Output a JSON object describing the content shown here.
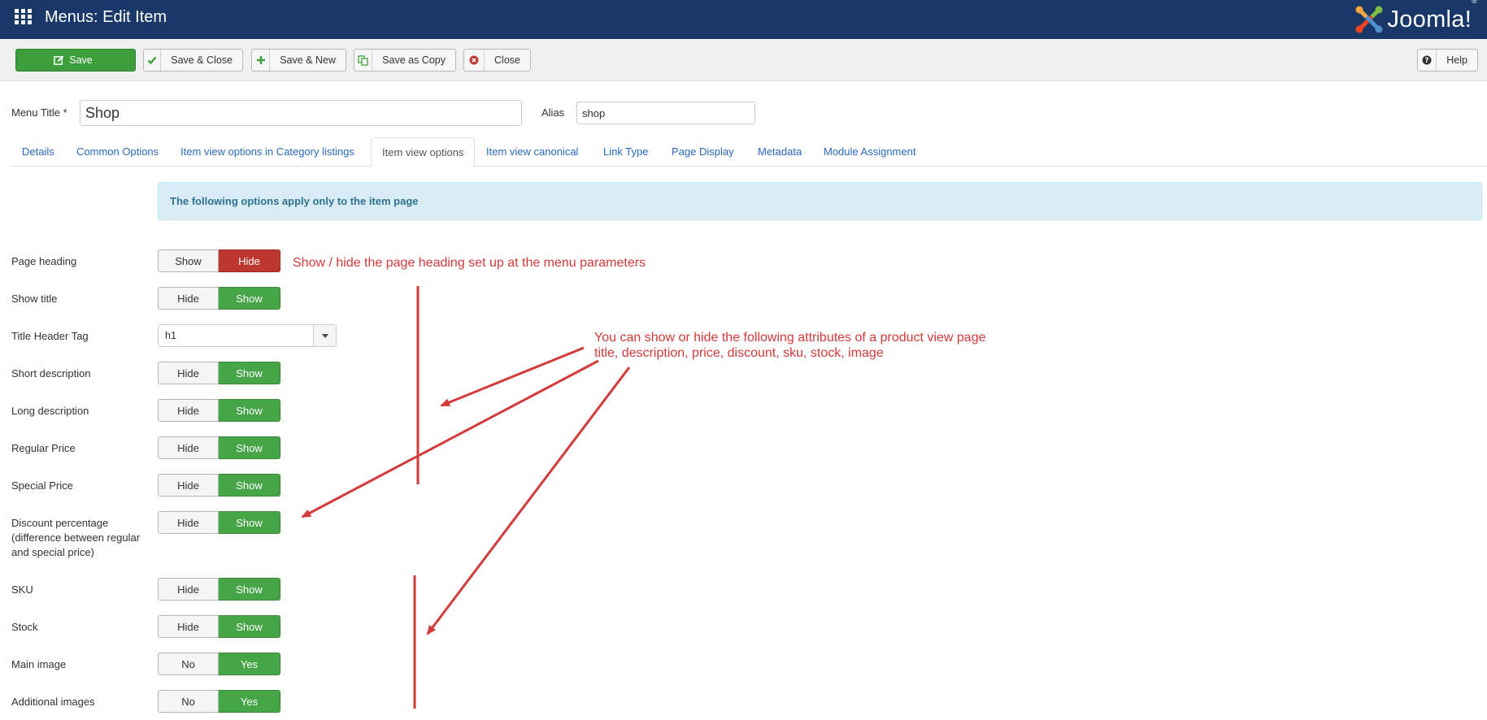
{
  "header": {
    "title": "Menus: Edit Item",
    "logo_text": "Joomla!",
    "logo_reg": "®"
  },
  "toolbar": {
    "save": "Save",
    "save_close": "Save & Close",
    "save_new": "Save & New",
    "save_copy": "Save as Copy",
    "close": "Close",
    "help": "Help"
  },
  "form": {
    "menu_title_label": "Menu Title *",
    "menu_title_value": "Shop",
    "alias_label": "Alias",
    "alias_value": "shop"
  },
  "tabs": [
    {
      "label": "Details"
    },
    {
      "label": "Common Options"
    },
    {
      "label": "Item view options in Category listings"
    },
    {
      "label": "Item view options"
    },
    {
      "label": "Item view canonical"
    },
    {
      "label": "Link Type"
    },
    {
      "label": "Page Display"
    },
    {
      "label": "Metadata"
    },
    {
      "label": "Module Assignment"
    }
  ],
  "active_tab": "Item view options",
  "info": "The following options apply only to the item page",
  "fields": [
    {
      "label": "Page heading",
      "options": [
        "Show",
        "Hide"
      ],
      "selected": "Hide"
    },
    {
      "label": "Show title",
      "options": [
        "Hide",
        "Show"
      ],
      "selected": "Show"
    },
    {
      "label": "Title Header Tag",
      "type": "select",
      "value": "h1"
    },
    {
      "label": "Short description",
      "options": [
        "Hide",
        "Show"
      ],
      "selected": "Show"
    },
    {
      "label": "Long description",
      "options": [
        "Hide",
        "Show"
      ],
      "selected": "Show"
    },
    {
      "label": "Regular Price",
      "options": [
        "Hide",
        "Show"
      ],
      "selected": "Show"
    },
    {
      "label": "Special Price",
      "options": [
        "Hide",
        "Show"
      ],
      "selected": "Show"
    },
    {
      "label_lines": [
        "Discount percentage",
        "(difference between regular",
        "and special price)"
      ],
      "options": [
        "Hide",
        "Show"
      ],
      "selected": "Show"
    },
    {
      "label": "SKU",
      "options": [
        "Hide",
        "Show"
      ],
      "selected": "Show"
    },
    {
      "label": "Stock",
      "options": [
        "Hide",
        "Show"
      ],
      "selected": "Show"
    },
    {
      "label": "Main image",
      "options": [
        "No",
        "Yes"
      ],
      "selected": "Yes"
    },
    {
      "label": "Additional images",
      "options": [
        "No",
        "Yes"
      ],
      "selected": "Yes"
    }
  ],
  "annotations": {
    "page_heading_note": "Show / hide the page heading set up at the menu parameters",
    "attributes_note_line1": "You can show or hide the following attributes of a product view page",
    "attributes_note_line2": "title, description, price, discount, sku, stock, image",
    "color": "#d33a3a"
  },
  "colors": {
    "header_bg": "#1a3867",
    "save_green": "#3c9f3c",
    "toggle_green": "#46a546",
    "toggle_red": "#bd362f",
    "tab_link": "#2a69b8"
  },
  "icons": {
    "menu": "grid-icon",
    "save": "edit-icon",
    "save_close": "check-icon",
    "save_new": "plus-icon",
    "save_copy": "copy-icon",
    "close": "close-circle-icon",
    "help": "question-circle-icon",
    "select_caret": "caret-down-icon"
  }
}
